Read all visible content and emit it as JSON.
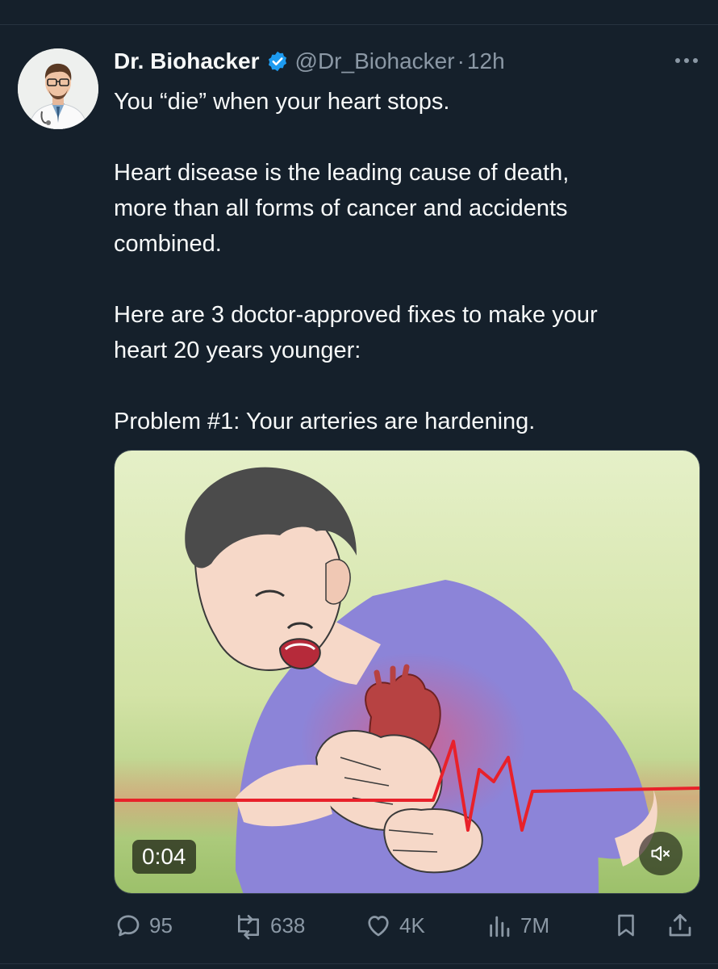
{
  "author": {
    "display_name": "Dr. Biohacker",
    "handle": "@Dr_Biohacker",
    "separator": "·",
    "time": "12h",
    "verified": true,
    "avatar_icon": "doctor-avatar"
  },
  "tweet": {
    "line1": "You “die” when your heart stops.",
    "line2": "Heart disease is the leading cause of death,",
    "line3": "more than all forms of cancer and accidents",
    "line4": "combined.",
    "line5": "Here are 3 doctor-approved fixes to make your",
    "line6": "heart 20 years younger:",
    "line7": "Problem #1: Your arteries are hardening."
  },
  "media": {
    "type": "video",
    "subject": "illustration of man clutching chest with heart and ECG line",
    "duration": "0:04",
    "muted": true
  },
  "actions": {
    "replies": "95",
    "reposts": "638",
    "likes": "4K",
    "views": "7M"
  },
  "colors": {
    "background": "#15202b",
    "text": "#f7f9f9",
    "secondary": "#8b98a5",
    "verified_blue": "#1d9bf0"
  }
}
